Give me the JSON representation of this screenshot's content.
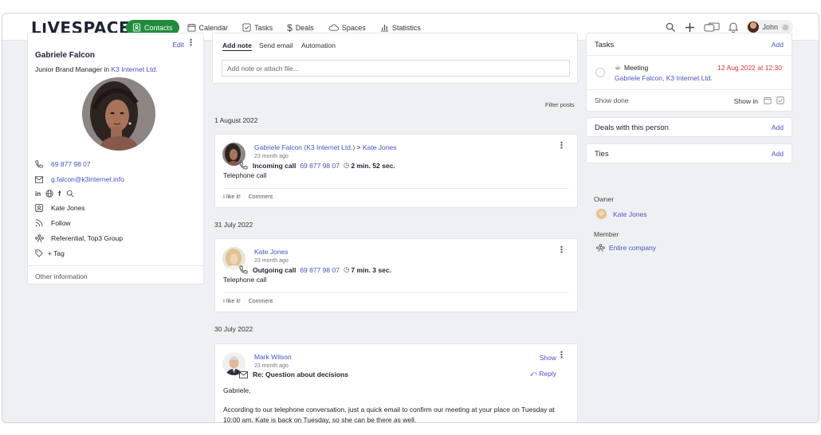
{
  "app": {
    "logo": "LIVESPACE"
  },
  "nav": [
    {
      "label": "Contacts",
      "icon": "contacts-icon",
      "active": true
    },
    {
      "label": "Calendar",
      "icon": "calendar-icon"
    },
    {
      "label": "Tasks",
      "icon": "tasks-icon"
    },
    {
      "label": "Deals",
      "icon": "dollar-icon"
    },
    {
      "label": "Spaces",
      "icon": "cloud-icon"
    },
    {
      "label": "Statistics",
      "icon": "statistics-icon"
    }
  ],
  "user": {
    "name": "John"
  },
  "contact": {
    "name": "Gabriele Falcon",
    "role_prefix": "Junior Brand Manager in",
    "company": "K3 Internet Ltd.",
    "edit_label": "Edit",
    "phone": "69 877 98 07",
    "email": "g.falcon@k3internet.info",
    "owner": "Kate Jones",
    "follow": "Follow",
    "groups": "Referential, Top3 Group",
    "tag": "+ Tag",
    "other_info": "Other information"
  },
  "composer": {
    "tabs": [
      "Add note",
      "Send email",
      "Automation"
    ],
    "placeholder": "Add note or attach file...",
    "filter_label": "Filter posts"
  },
  "feed": [
    {
      "date": "1 August 2022",
      "author": "Gabriele Falcon (K3 Internet Ltd.)",
      "arrow": ">",
      "recipient": "Kate Jones",
      "time_ago": "23 month ago",
      "type": "Incoming call",
      "phone": "69 877 98 07",
      "duration": "2 min. 52 sec.",
      "body": "Telephone call",
      "like": "I like it!",
      "comment": "Comment"
    },
    {
      "date": "31 July 2022",
      "author": "Kate Jones",
      "time_ago": "23 month ago",
      "type": "Outgoing call",
      "phone": "69 877 98 07",
      "duration": "7 min. 3 sec.",
      "body": "Telephone call",
      "like": "I like it!",
      "comment": "Comment"
    },
    {
      "date": "30 July 2022",
      "author": "Mark Wilson",
      "time_ago": "23 month ago",
      "subject": "Re: Question about decisions",
      "show_label": "Show",
      "reply_label": "Reply",
      "greeting": "Gabriele,",
      "body": "According to our telephone conversation, just a quick email to confirm our meeting at your place on Tuesday at 10:00 am. Kate is back on Tuesday, so she can be there as well."
    }
  ],
  "tasks": {
    "title": "Tasks",
    "add_label": "Add",
    "item": {
      "type": "Meeting",
      "with": "Gabriele Falcon, K3 Internet Ltd.",
      "due": "12 Aug 2022 at 12:30"
    },
    "show_done": "Show done",
    "show_in": "Show in"
  },
  "deals": {
    "title": "Deals with this person",
    "add_label": "Add"
  },
  "ties": {
    "title": "Ties",
    "add_label": "Add"
  },
  "access": {
    "owner_label": "Owner",
    "owner": "Kate Jones",
    "member_label": "Member",
    "member": "Entire company"
  },
  "colors": {
    "brand_green": "#1f8c3a",
    "link": "#4a52c6",
    "due_red": "#d9363e"
  }
}
